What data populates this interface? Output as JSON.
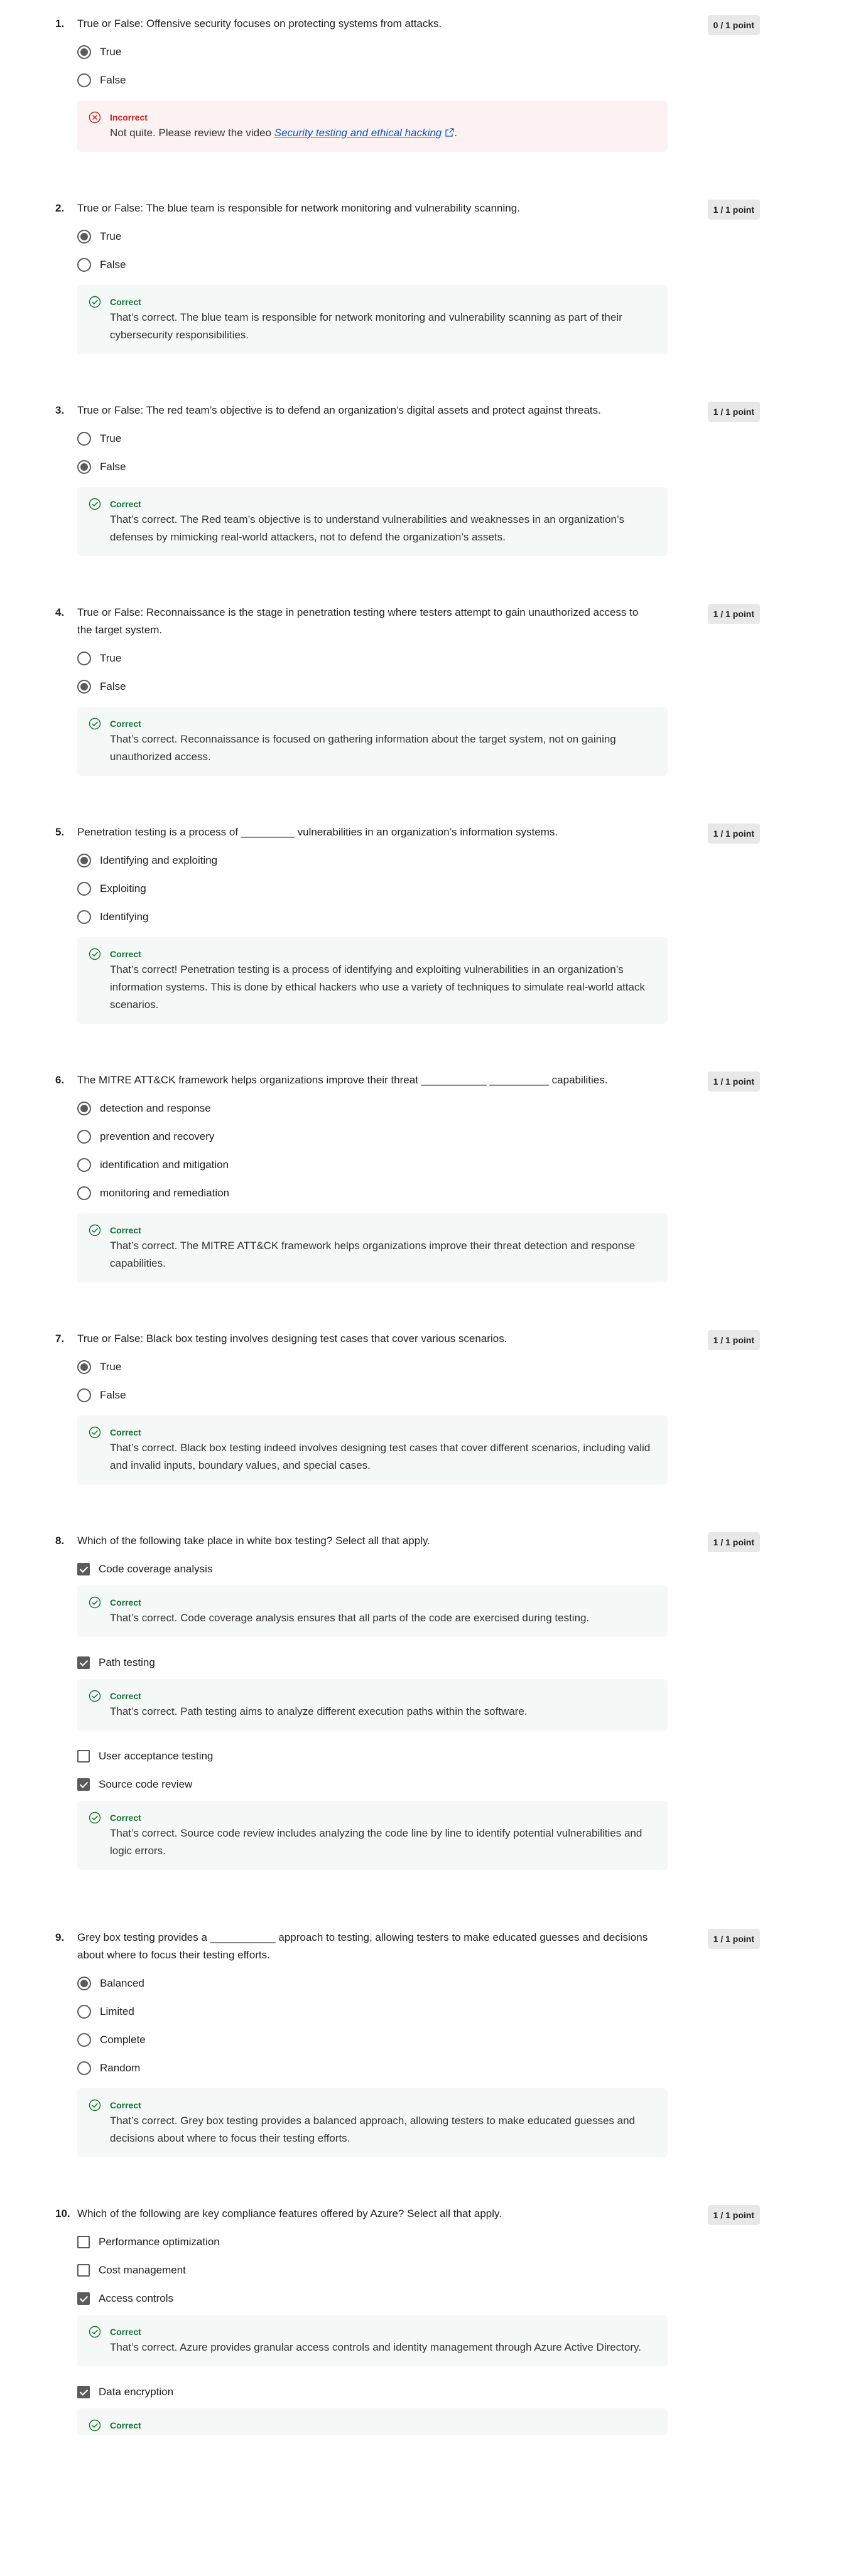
{
  "questions": [
    {
      "number": "1.",
      "text": "True or False: Offensive security focuses on protecting systems from attacks.",
      "points": "0 / 1 point",
      "type": "radio",
      "options": [
        {
          "label": "True",
          "checked": true
        },
        {
          "label": "False",
          "checked": false
        }
      ],
      "feedback": {
        "status": "Incorrect",
        "kind": "incorrect",
        "text_before": "Not quite. Please review the video ",
        "link": "Security testing and ethical hacking",
        "text_after": "."
      }
    },
    {
      "number": "2.",
      "text": "True or False: The blue team is responsible for network monitoring and vulnerability scanning.",
      "points": "1 / 1 point",
      "type": "radio",
      "options": [
        {
          "label": "True",
          "checked": true
        },
        {
          "label": "False",
          "checked": false
        }
      ],
      "feedback": {
        "status": "Correct",
        "kind": "correct",
        "text": "That’s correct. The blue team is responsible for network monitoring and vulnerability scanning as part of their cybersecurity responsibilities."
      }
    },
    {
      "number": "3.",
      "text": "True or False: The red team’s objective is to defend an organization’s digital assets and protect against threats.",
      "points": "1 / 1 point",
      "type": "radio",
      "options": [
        {
          "label": "True",
          "checked": false
        },
        {
          "label": "False",
          "checked": true
        }
      ],
      "feedback": {
        "status": "Correct",
        "kind": "correct",
        "text": "That’s correct. The Red team’s objective is to understand vulnerabilities and weaknesses in an organization’s defenses by mimicking real-world attackers, not to defend the organization’s assets."
      }
    },
    {
      "number": "4.",
      "text": "True or False: Reconnaissance is the stage in penetration testing where testers attempt to gain unauthorized access to the target system.",
      "points": "1 / 1 point",
      "type": "radio",
      "options": [
        {
          "label": "True",
          "checked": false
        },
        {
          "label": "False",
          "checked": true
        }
      ],
      "feedback": {
        "status": "Correct",
        "kind": "correct",
        "text": "That’s correct. Reconnaissance is focused on gathering information about the target system, not on gaining unauthorized access."
      }
    },
    {
      "number": "5.",
      "text": "Penetration testing is a process of _________ vulnerabilities in an organization’s information systems.",
      "points": "1 / 1 point",
      "type": "radio",
      "options": [
        {
          "label": "Identifying and exploiting",
          "checked": true
        },
        {
          "label": "Exploiting",
          "checked": false
        },
        {
          "label": "Identifying",
          "checked": false
        }
      ],
      "feedback": {
        "status": "Correct",
        "kind": "correct",
        "text": "That’s correct! Penetration testing is a process of identifying and exploiting vulnerabilities in an organization’s information systems. This is done by ethical hackers who use a variety of techniques to simulate real-world attack scenarios."
      }
    },
    {
      "number": "6.",
      "text": "The MITRE ATT&CK framework helps organizations improve their threat ___________ __________ capabilities.",
      "points": "1 / 1 point",
      "type": "radio",
      "options": [
        {
          "label": "detection and response",
          "checked": true
        },
        {
          "label": "prevention and recovery",
          "checked": false
        },
        {
          "label": "identification and mitigation",
          "checked": false
        },
        {
          "label": "monitoring and remediation",
          "checked": false
        }
      ],
      "feedback": {
        "status": "Correct",
        "kind": "correct",
        "text": "That’s correct. The MITRE ATT&CK framework helps organizations improve their threat detection and response capabilities."
      }
    },
    {
      "number": "7.",
      "text": "True or False: Black box testing involves designing test cases that cover various scenarios.",
      "points": "1 / 1 point",
      "type": "radio",
      "options": [
        {
          "label": "True",
          "checked": true
        },
        {
          "label": "False",
          "checked": false
        }
      ],
      "feedback": {
        "status": "Correct",
        "kind": "correct",
        "text": "That’s correct. Black box testing indeed involves designing test cases that cover different scenarios, including valid and invalid inputs, boundary values, and special cases."
      }
    },
    {
      "number": "8.",
      "text": "Which of the following take place in white box testing? Select all that apply.",
      "points": "1 / 1 point",
      "type": "checkbox",
      "options": [
        {
          "label": "Code coverage analysis",
          "checked": true,
          "feedback": {
            "status": "Correct",
            "kind": "correct",
            "text": "That’s correct. Code coverage analysis ensures that all parts of the code are exercised during testing."
          }
        },
        {
          "label": "Path testing",
          "checked": true,
          "feedback": {
            "status": "Correct",
            "kind": "correct",
            "text": "That’s correct. Path testing aims to analyze different execution paths within the software."
          }
        },
        {
          "label": "User acceptance testing",
          "checked": false
        },
        {
          "label": "Source code review",
          "checked": true,
          "feedback": {
            "status": "Correct",
            "kind": "correct",
            "text": "That’s correct. Source code review includes analyzing the code line by line to identify potential vulnerabilities and logic errors."
          }
        }
      ]
    },
    {
      "number": "9.",
      "text": "Grey box testing provides a ___________ approach to testing, allowing testers to make educated guesses and decisions about where to focus their testing efforts.",
      "points": "1 / 1 point",
      "type": "radio",
      "options": [
        {
          "label": "Balanced",
          "checked": true
        },
        {
          "label": "Limited",
          "checked": false
        },
        {
          "label": "Complete",
          "checked": false
        },
        {
          "label": "Random",
          "checked": false
        }
      ],
      "feedback": {
        "status": "Correct",
        "kind": "correct",
        "text": "That’s correct. Grey box testing provides a balanced approach, allowing testers to make educated guesses and decisions about where to focus their testing efforts."
      }
    },
    {
      "number": "10.",
      "text": "Which of the following are key compliance features offered by Azure? Select all that apply.",
      "points": "1 / 1 point",
      "type": "checkbox",
      "options": [
        {
          "label": "Performance optimization",
          "checked": false
        },
        {
          "label": "Cost management",
          "checked": false
        },
        {
          "label": "Access controls",
          "checked": true,
          "feedback": {
            "status": "Correct",
            "kind": "correct",
            "text": "That’s correct. Azure provides granular access controls and identity management through Azure Active Directory."
          }
        },
        {
          "label": "Data encryption",
          "checked": true,
          "feedback": {
            "status": "Correct",
            "kind": "correct",
            "text": ""
          }
        }
      ]
    }
  ],
  "icons": {
    "correct": "check-circle-icon",
    "incorrect": "x-circle-icon",
    "external_link": "external-link-icon"
  },
  "colors": {
    "correct": "#137333",
    "incorrect": "#c5221f",
    "correct_bg": "#f4f8f6",
    "incorrect_bg": "#fdf2f2",
    "points_badge": "#e8e8e8",
    "link": "#0056d2"
  }
}
